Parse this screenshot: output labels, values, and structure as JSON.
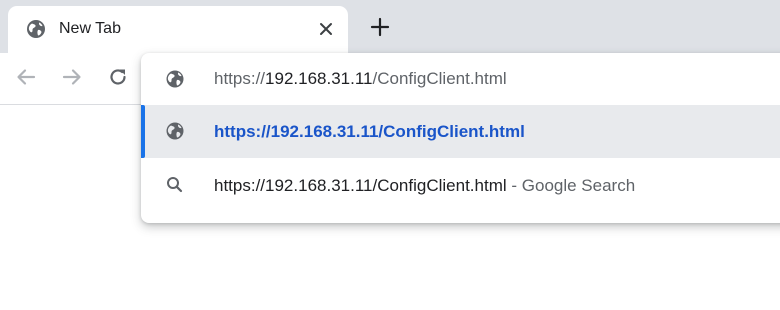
{
  "tab": {
    "title": "New Tab",
    "favicon": "globe-icon",
    "close_icon": "close-icon"
  },
  "new_tab_icon": "plus-icon",
  "toolbar": {
    "back_icon": "back-arrow-icon",
    "forward_icon": "forward-arrow-icon",
    "reload_icon": "reload-icon"
  },
  "omnibox": {
    "input": {
      "prefix": "https://",
      "host": "192.168.31.11",
      "path": "/ConfigClient.html",
      "icon": "globe-icon"
    },
    "suggestions": [
      {
        "icon": "globe-icon",
        "text": "https://192.168.31.11/ConfigClient.html",
        "selected": true
      },
      {
        "icon": "search-icon",
        "query": "https://192.168.31.11/ConfigClient.html",
        "separator": " - ",
        "engine": "Google Search",
        "selected": false
      }
    ]
  },
  "colors": {
    "tabstrip": "#dee1e6",
    "selected_row": "#e8eaed",
    "selection_bar": "#1a73e8",
    "url_link": "#1a55c9"
  }
}
